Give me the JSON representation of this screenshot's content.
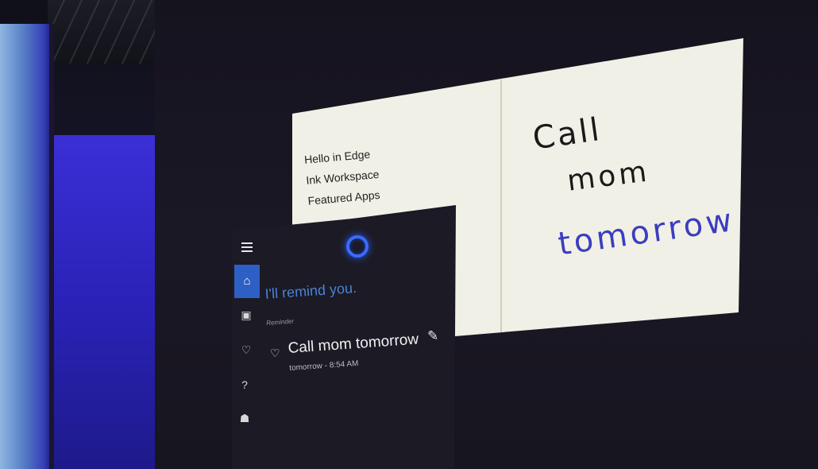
{
  "edge": {
    "menu": [
      "Hello in Edge",
      "Ink Workspace",
      "Featured Apps"
    ],
    "ink": {
      "line1": "Call",
      "line2": "mom",
      "line3": "tomorrow"
    },
    "colors": {
      "ink_black": "#1a1a1a",
      "ink_blue": "#3b3dc0",
      "paper": "#f1f0e6"
    }
  },
  "cortana": {
    "nav_icons": [
      "menu-icon",
      "home-icon",
      "notebook-icon",
      "lightbulb-icon",
      "help-icon",
      "feedback-icon"
    ],
    "reply": "I'll remind you.",
    "section_label": "Reminder",
    "reminder": {
      "title": "Call mom tomorrow",
      "time": "tomorrow - 8:54 AM"
    },
    "colors": {
      "accent": "#2e5fc4",
      "reply_text": "#4a82d8",
      "ring": "#3a6cff"
    }
  }
}
